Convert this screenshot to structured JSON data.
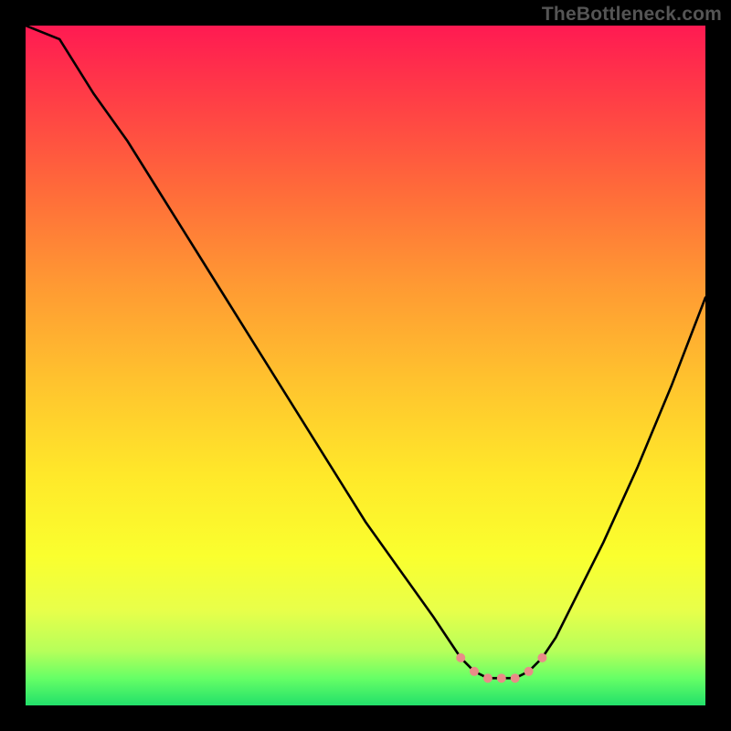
{
  "watermark": "TheBottleneck.com",
  "chart_data": {
    "type": "line",
    "title": "",
    "xlabel": "",
    "ylabel": "",
    "xlim": [
      0,
      100
    ],
    "ylim": [
      0,
      100
    ],
    "series": [
      {
        "name": "bottleneck-curve",
        "x": [
          0,
          5,
          10,
          15,
          20,
          25,
          30,
          35,
          40,
          45,
          50,
          55,
          60,
          62,
          64,
          66,
          68,
          70,
          72,
          74,
          76,
          78,
          80,
          85,
          90,
          95,
          100
        ],
        "values": [
          100,
          98,
          90,
          83,
          75,
          67,
          59,
          51,
          43,
          35,
          27,
          20,
          13,
          10,
          7,
          5,
          4,
          4,
          4,
          5,
          7,
          10,
          14,
          24,
          35,
          47,
          60
        ]
      }
    ],
    "markers": [
      {
        "name": "trough-left",
        "x": 64,
        "y": 7,
        "color": "#e98c88"
      },
      {
        "name": "trough-a",
        "x": 66,
        "y": 5,
        "color": "#e98c88"
      },
      {
        "name": "trough-b",
        "x": 68,
        "y": 4,
        "color": "#e98c88"
      },
      {
        "name": "trough-min",
        "x": 70,
        "y": 4,
        "color": "#e98c88"
      },
      {
        "name": "trough-c",
        "x": 72,
        "y": 4,
        "color": "#e98c88"
      },
      {
        "name": "trough-d",
        "x": 74,
        "y": 5,
        "color": "#e98c88"
      },
      {
        "name": "trough-right",
        "x": 76,
        "y": 7,
        "color": "#e98c88"
      }
    ]
  }
}
